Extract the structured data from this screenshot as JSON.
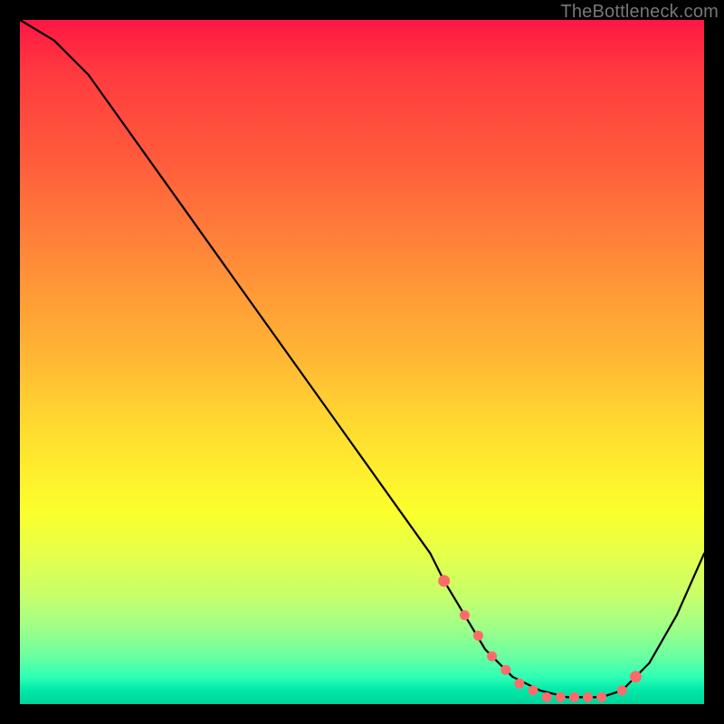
{
  "watermark": "TheBottleneck.com",
  "chart_data": {
    "type": "line",
    "title": "",
    "xlabel": "",
    "ylabel": "",
    "xlim": [
      0,
      100
    ],
    "ylim": [
      0,
      100
    ],
    "grid": false,
    "legend": false,
    "gradient_colors": {
      "top": "#ff1744",
      "mid": "#ffee2e",
      "bottom": "#00d49a"
    },
    "series": [
      {
        "name": "curve",
        "x": [
          0,
          5,
          10,
          15,
          20,
          25,
          30,
          35,
          40,
          45,
          50,
          55,
          60,
          62,
          65,
          68,
          72,
          76,
          80,
          83,
          85,
          88,
          92,
          96,
          100
        ],
        "y": [
          100,
          97,
          92,
          85,
          78,
          71,
          64,
          57,
          50,
          43,
          36,
          29,
          22,
          18,
          13,
          8,
          4,
          2,
          1,
          1,
          1,
          2,
          6,
          13,
          22
        ]
      }
    ],
    "highlight_points": {
      "name": "dots",
      "x": [
        62,
        65,
        67,
        69,
        71,
        73,
        75,
        77,
        79,
        81,
        83,
        85,
        88,
        90
      ],
      "y": [
        18,
        13,
        10,
        7,
        5,
        3,
        2,
        1,
        1,
        1,
        1,
        1,
        2,
        4
      ]
    }
  }
}
